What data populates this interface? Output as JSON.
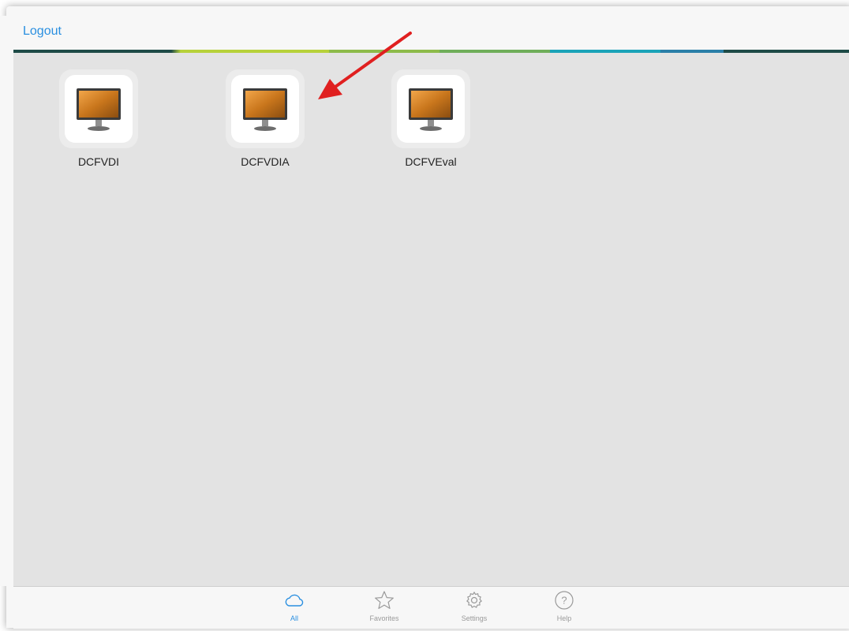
{
  "header": {
    "logout_label": "Logout"
  },
  "colors": {
    "accent": "#2a8fe0",
    "annotation_arrow": "#e02020",
    "stripe": [
      "#1e4b47",
      "#b7d13a",
      "#8dbb4a",
      "#6fae5a",
      "#1aa3b8",
      "#2a7fa8",
      "#1e4b47"
    ]
  },
  "desktops": [
    {
      "name": "DCFVDI",
      "icon": "monitor-icon"
    },
    {
      "name": "DCFVDIA",
      "icon": "monitor-icon"
    },
    {
      "name": "DCFVEval",
      "icon": "monitor-icon"
    }
  ],
  "tabbar": {
    "items": [
      {
        "label": "All",
        "icon": "cloud-icon",
        "active": true
      },
      {
        "label": "Favorites",
        "icon": "star-icon",
        "active": false
      },
      {
        "label": "Settings",
        "icon": "gear-icon",
        "active": false
      },
      {
        "label": "Help",
        "icon": "help-icon",
        "active": false
      }
    ]
  }
}
